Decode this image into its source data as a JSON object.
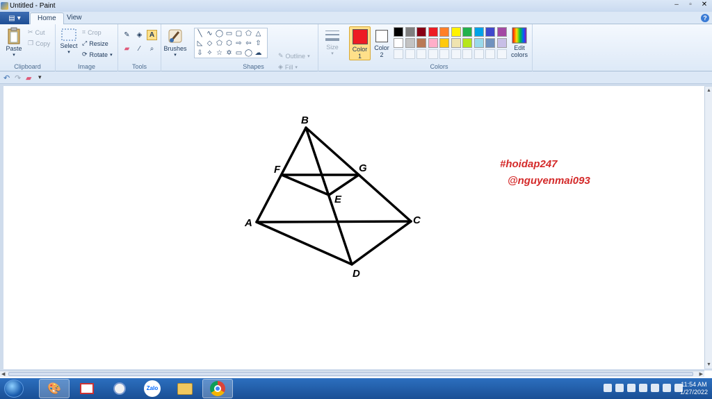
{
  "window": {
    "title": "Untitled - Paint",
    "controls": [
      "–",
      "▫",
      "✕"
    ]
  },
  "tabs": {
    "file_glyph": "▤",
    "home": "Home",
    "view": "View",
    "help": "?"
  },
  "ribbon": {
    "clipboard": {
      "group": "Clipboard",
      "paste": "Paste",
      "cut": "Cut",
      "copy": "Copy"
    },
    "image": {
      "group": "Image",
      "select": "Select",
      "crop": "Crop",
      "resize": "Resize",
      "rotate": "Rotate"
    },
    "tools": {
      "group": "Tools"
    },
    "brushes": {
      "label": "Brushes"
    },
    "shapes": {
      "group": "Shapes",
      "outline": "Outline",
      "fill": "Fill"
    },
    "size": {
      "label": "Size"
    },
    "colors": {
      "group": "Colors",
      "color1_label": "Color 1",
      "color2_label": "Color 2",
      "color1": "#ed1c24",
      "color2": "#ffffff",
      "edit_colors": "Edit colors",
      "palette_row1": [
        "#000000",
        "#7f7f7f",
        "#880015",
        "#ed1c24",
        "#ff7f27",
        "#fff200",
        "#22b14c",
        "#00a2e8",
        "#3f48cc",
        "#a349a4"
      ],
      "palette_row2": [
        "#ffffff",
        "#c3c3c3",
        "#b97a57",
        "#ffaec9",
        "#ffc90e",
        "#efe4b0",
        "#b5e61d",
        "#99d9ea",
        "#7092be",
        "#c8bfe7"
      ]
    }
  },
  "canvas": {
    "points": {
      "B": "B",
      "F": "F",
      "G": "G",
      "E": "E",
      "A": "A",
      "C": "C",
      "D": "D"
    },
    "watermark1": "#hoidap247",
    "watermark2": "@nguyenmai093",
    "watermark_color": "#d42a2a"
  },
  "taskbar": {
    "zalo": "Zalo",
    "clock_time": "11:54 AM",
    "clock_date": "1/27/2022"
  }
}
